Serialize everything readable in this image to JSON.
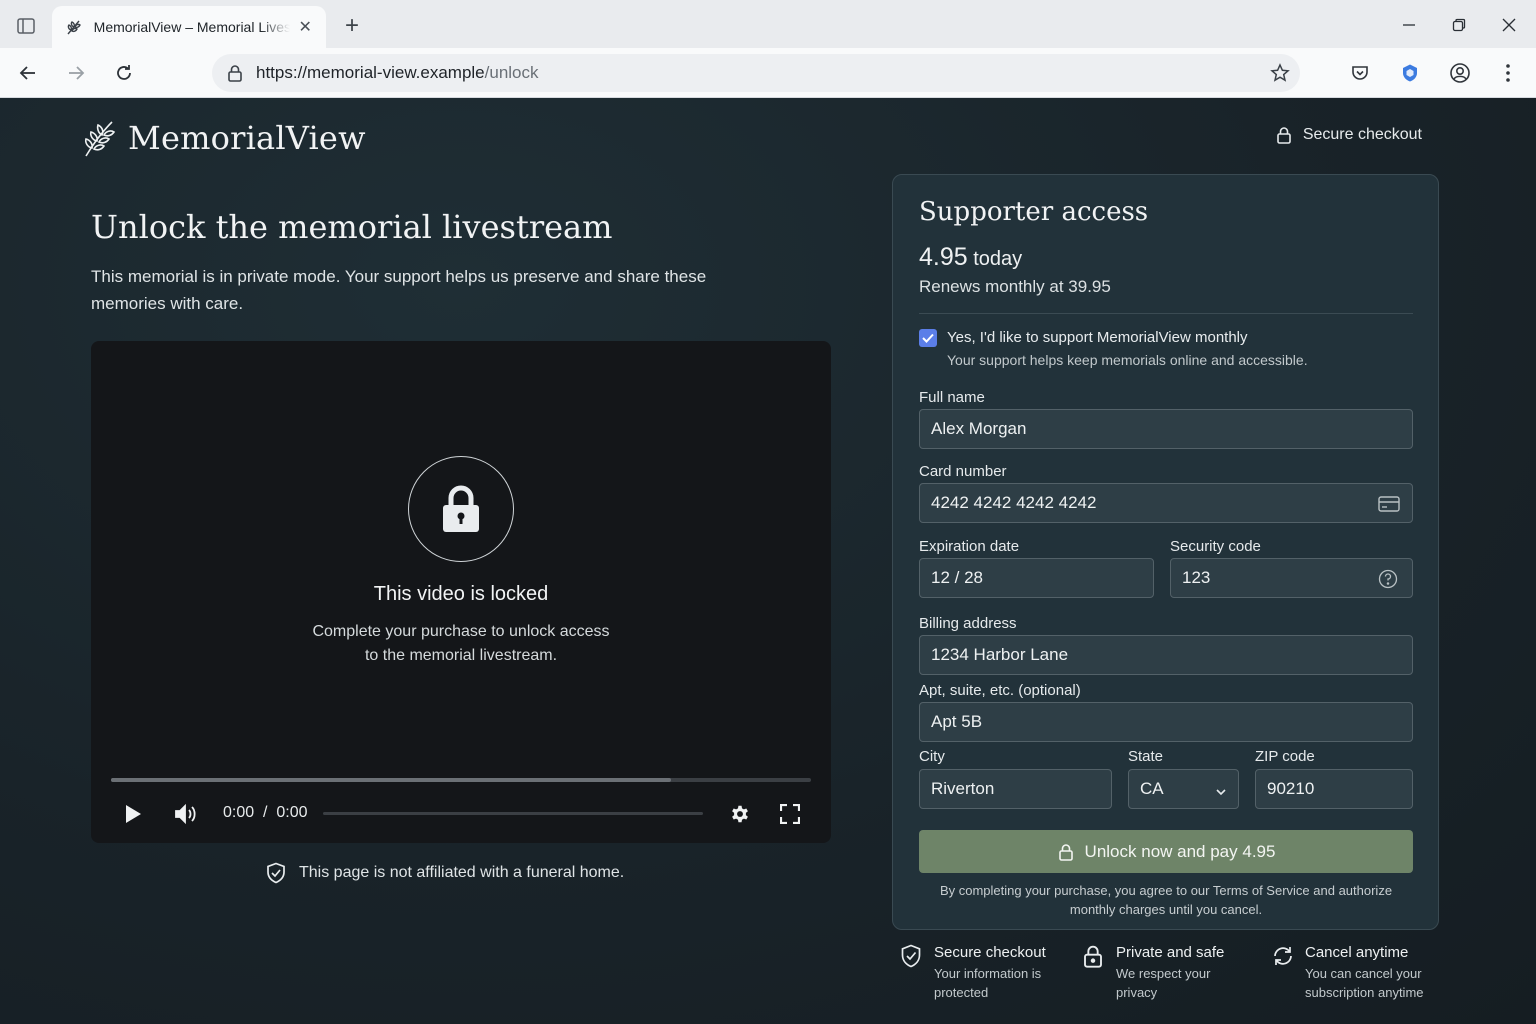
{
  "browser": {
    "tab_title": "MemorialView – Memorial Livestream",
    "url_host": "https://memorial-view.example",
    "url_path": "/unlock"
  },
  "header": {
    "brand": "MemorialView",
    "secure_label": "Secure checkout"
  },
  "main": {
    "headline": "Unlock the memorial livestream",
    "subline": "This memorial is in private mode. Your support helps us preserve and share these memories with care."
  },
  "player": {
    "locked_title": "This video is locked",
    "locked_desc": "Complete your purchase to unlock access to the memorial livestream.",
    "time": "0:00  /  0:00",
    "buffered_fraction": 0.8
  },
  "disclaimer": "This page is not affiliated with a funeral home.",
  "checkout": {
    "title": "Supporter access",
    "price_amount": "4.95",
    "price_suffix": "today",
    "renews": "Renews monthly at 39.95",
    "checkbox_checked": true,
    "checkbox_label": "Yes, I'd like to support MemorialView monthly",
    "checkbox_sub": "Your support helps keep memorials online and accessible.",
    "fields": {
      "full_name": {
        "label": "Full name",
        "value": "Alex Morgan"
      },
      "card_number": {
        "label": "Card number",
        "value": "4242 4242 4242 4242"
      },
      "expiration": {
        "label": "Expiration date",
        "value": "12 / 28"
      },
      "security_code": {
        "label": "Security code",
        "value": "123"
      },
      "billing_address": {
        "label": "Billing address",
        "value": "1234 Harbor Lane"
      },
      "apt": {
        "label": "Apt, suite, etc. (optional)",
        "value": "Apt 5B"
      },
      "city": {
        "label": "City",
        "value": "Riverton"
      },
      "state": {
        "label": "State",
        "value": "CA"
      },
      "zip": {
        "label": "ZIP code",
        "value": "90210"
      }
    },
    "pay_button": "Unlock now and pay 4.95",
    "terms": "By completing your purchase, you agree to our Terms of Service and authorize monthly charges until you cancel."
  },
  "features": [
    {
      "title": "Secure checkout",
      "desc": "Your information is protected",
      "icon": "shield-check-icon"
    },
    {
      "title": "Private and safe",
      "desc": "We respect your privacy",
      "icon": "lock-icon"
    },
    {
      "title": "Cancel anytime",
      "desc": "You can cancel your subscription anytime",
      "icon": "refresh-icon"
    }
  ],
  "colors": {
    "page_bg": "#1a262d",
    "card_bg": "#22323a",
    "pay_button": "#6e8468",
    "checkbox": "#5b7ee8"
  }
}
